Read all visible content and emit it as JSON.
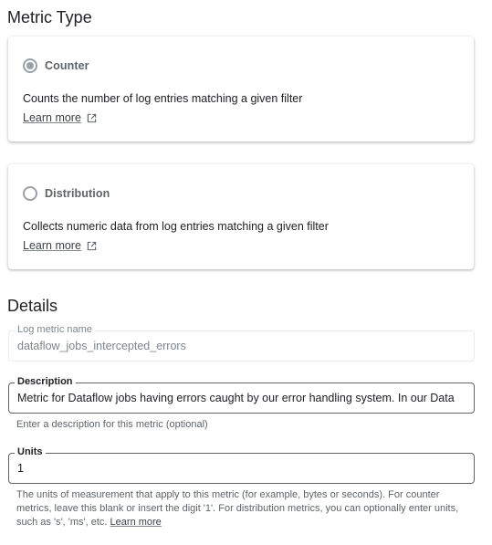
{
  "metric_type": {
    "title": "Metric Type",
    "counter": {
      "label": "Counter",
      "selected": true,
      "description": "Counts the number of log entries matching a given filter",
      "learn_more": "Learn more"
    },
    "distribution": {
      "label": "Distribution",
      "selected": false,
      "description": "Collects numeric data from log entries matching a given filter",
      "learn_more": "Learn more"
    }
  },
  "details": {
    "title": "Details",
    "log_metric_name": {
      "label": "Log metric name",
      "value": "dataflow_jobs_intercepted_errors"
    },
    "description": {
      "label": "Description",
      "value": "Metric for Dataflow jobs having errors caught by our error handling system. In our Data",
      "hint": "Enter a description for this metric (optional)"
    },
    "units": {
      "label": "Units",
      "value": "1",
      "hint_text": "The units of measurement that apply to this metric (for example, bytes or seconds). For counter metrics, leave this blank or insert the digit '1'. For distribution metrics, you can optionally enter units, such as 's', 'ms', etc.",
      "hint_link": "Learn more"
    }
  },
  "icons": {
    "external_link": "open-in-new-icon"
  }
}
